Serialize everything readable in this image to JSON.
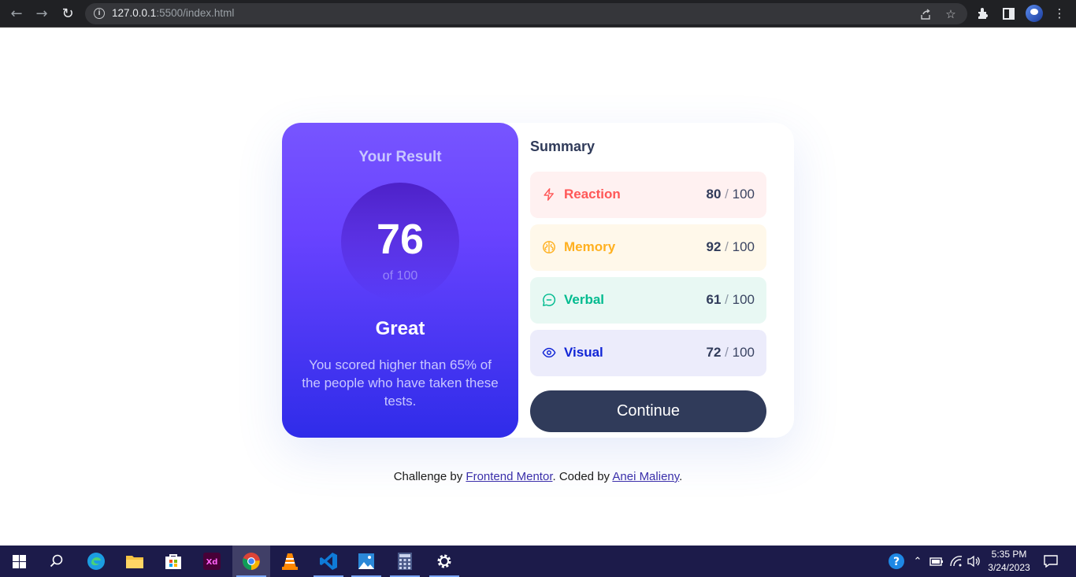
{
  "browser": {
    "url_host": "127.0.0.1",
    "url_path": ":5500/index.html"
  },
  "result": {
    "title": "Your Result",
    "score": "76",
    "of_text": "of 100",
    "grade": "Great",
    "description": "You scored higher than 65% of the people who have taken these tests."
  },
  "summary": {
    "title": "Summary",
    "items": [
      {
        "label": "Reaction",
        "score": "80",
        "max": "100",
        "icon": "lightning-icon",
        "color": "#ff5757",
        "bg": "#fff1f1"
      },
      {
        "label": "Memory",
        "score": "92",
        "max": "100",
        "icon": "brain-icon",
        "color": "#ffb01f",
        "bg": "#fff8ea"
      },
      {
        "label": "Verbal",
        "score": "61",
        "max": "100",
        "icon": "chat-icon",
        "color": "#00bb8f",
        "bg": "#e8f8f3"
      },
      {
        "label": "Visual",
        "score": "72",
        "max": "100",
        "icon": "eye-icon",
        "color": "#1125d6",
        "bg": "#ececfb"
      }
    ],
    "continue_label": "Continue"
  },
  "attribution": {
    "prefix": "Challenge by ",
    "link1": "Frontend Mentor",
    "middle": ". Coded by ",
    "link2": "Anei Malieny",
    "suffix": "."
  },
  "taskbar": {
    "time": "5:35 PM",
    "date": "3/24/2023"
  }
}
